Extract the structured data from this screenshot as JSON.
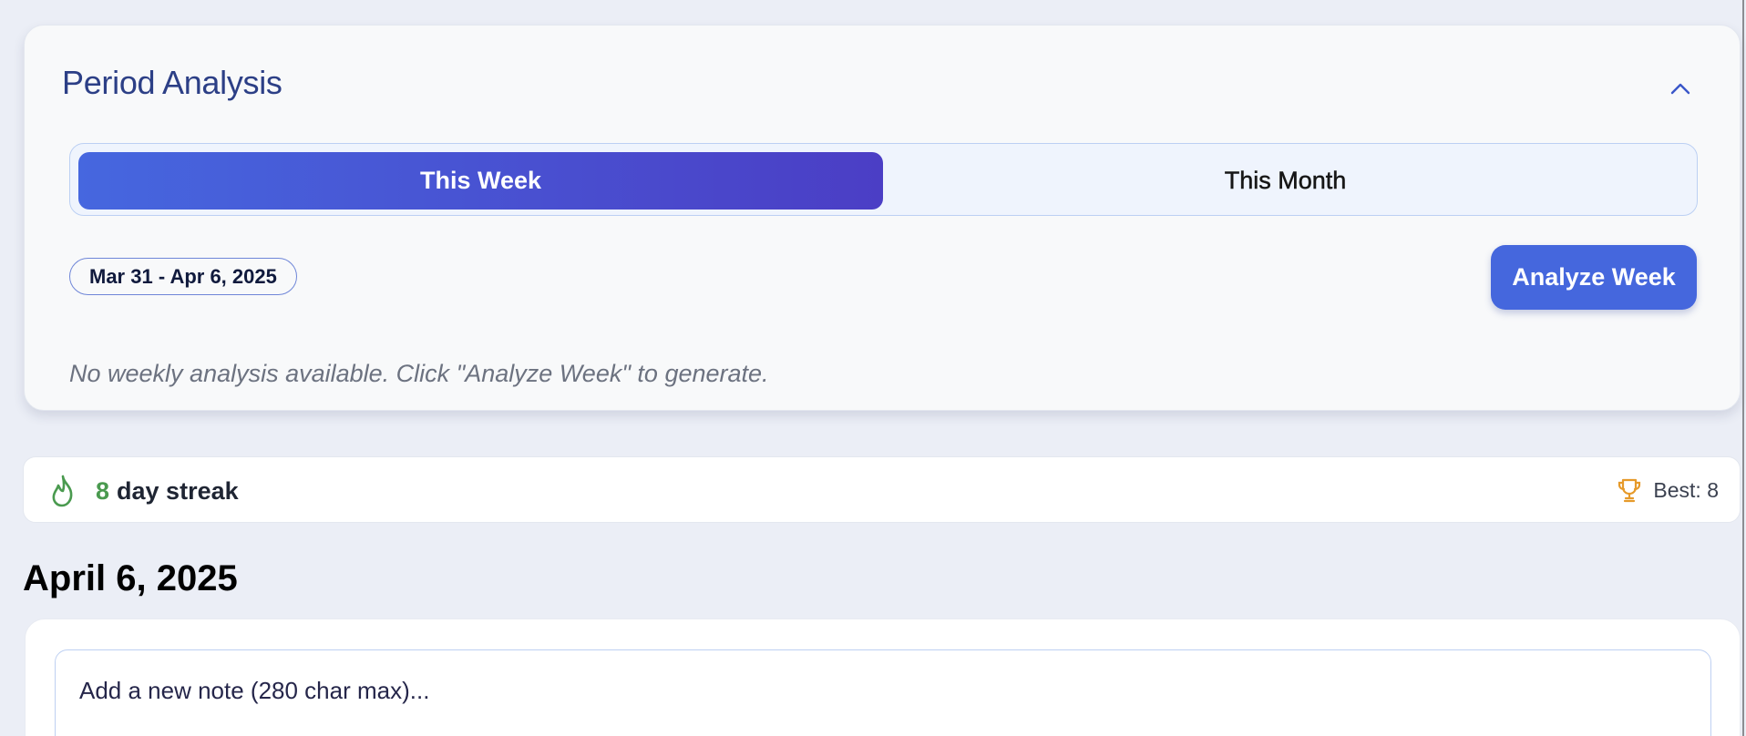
{
  "period_analysis": {
    "title": "Period Analysis",
    "collapse_icon": "chevron-up-icon",
    "tabs": [
      {
        "label": "This Week",
        "active": true
      },
      {
        "label": "This Month",
        "active": false
      }
    ],
    "date_range": "Mar 31 - Apr 6, 2025",
    "analyze_button": "Analyze Week",
    "empty_message": "No weekly analysis available. Click \"Analyze Week\" to generate."
  },
  "streak": {
    "icon": "flame-icon",
    "count": "8",
    "label": "day streak",
    "best_icon": "trophy-icon",
    "best": "Best: 8"
  },
  "day": {
    "heading": "April 6, 2025"
  },
  "note": {
    "placeholder": "Add a new note (280 char max)..."
  },
  "colors": {
    "accent": "#4567dd",
    "title": "#2c3f86",
    "streak_green": "#4a9a4f",
    "trophy_orange": "#e69a2a"
  }
}
